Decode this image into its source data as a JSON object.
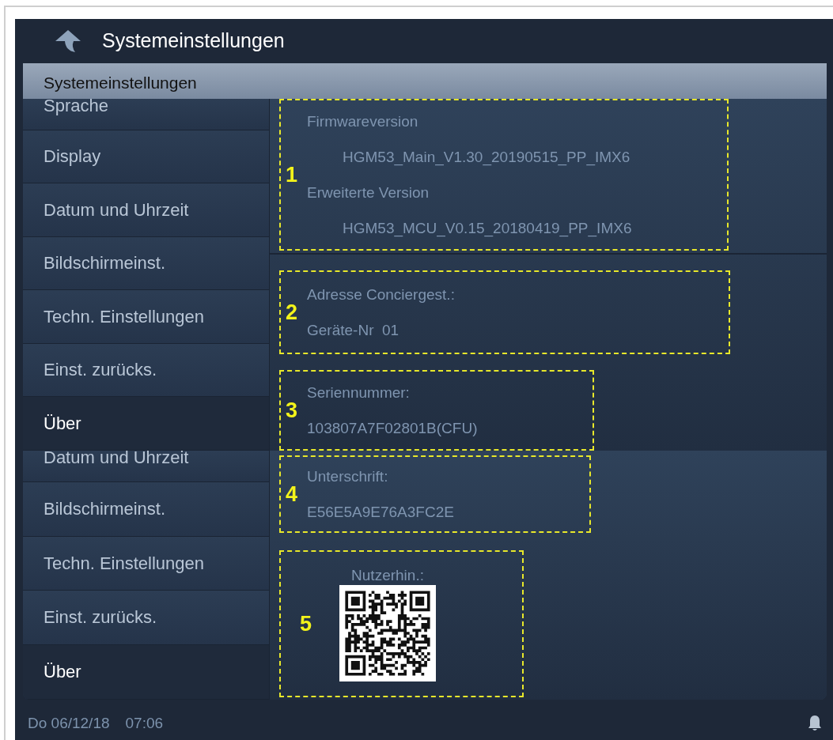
{
  "header": {
    "title": "Systemeinstellungen"
  },
  "subheader": {
    "title": "Systemeinstellungen"
  },
  "panels": [
    {
      "menu": [
        {
          "label": "Sprache",
          "selected": false,
          "cut": true
        },
        {
          "label": "Display",
          "selected": false
        },
        {
          "label": "Datum und Uhrzeit",
          "selected": false
        },
        {
          "label": "Bildschirmeinst.",
          "selected": false
        },
        {
          "label": "Techn. Einstellungen",
          "selected": false
        },
        {
          "label": "Einst. zurücks.",
          "selected": false
        },
        {
          "label": "Über",
          "selected": true
        }
      ],
      "callouts": [
        {
          "number": "1",
          "items": [
            {
              "kind": "label",
              "text": "Firmwareversion"
            },
            {
              "kind": "indented",
              "text": "HGM53_Main_V1.30_20190515_PP_IMX6"
            },
            {
              "kind": "label",
              "text": "Erweiterte Version"
            },
            {
              "kind": "indented",
              "text": "HGM53_MCU_V0.15_20180419_PP_IMX6"
            }
          ]
        },
        {
          "number": "2",
          "items": [
            {
              "kind": "label",
              "text": "Adresse Conciergest.:"
            },
            {
              "kind": "label",
              "text": "Geräte-Nr  01"
            }
          ]
        },
        {
          "number": "3",
          "items": [
            {
              "kind": "label",
              "text": "Seriennummer:"
            },
            {
              "kind": "label",
              "text": "103807A7F02801B(CFU)"
            }
          ]
        }
      ]
    },
    {
      "menu": [
        {
          "label": "Datum und Uhrzeit",
          "selected": false,
          "cut": true
        },
        {
          "label": "Bildschirmeinst.",
          "selected": false
        },
        {
          "label": "Techn. Einstellungen",
          "selected": false
        },
        {
          "label": "Einst. zurücks.",
          "selected": false
        },
        {
          "label": "Über",
          "selected": true
        }
      ],
      "callouts": [
        {
          "number": "4",
          "items": [
            {
              "kind": "label",
              "text": "Unterschrift:"
            },
            {
              "kind": "label",
              "text": "E56E5A9E76A3FC2E"
            }
          ]
        },
        {
          "number": "5",
          "items": [
            {
              "kind": "caption",
              "text": "Nutzerhin.:"
            },
            {
              "kind": "qr"
            }
          ]
        }
      ]
    }
  ],
  "status_bar": {
    "date": "Do 06/12/18",
    "time": "07:06"
  }
}
